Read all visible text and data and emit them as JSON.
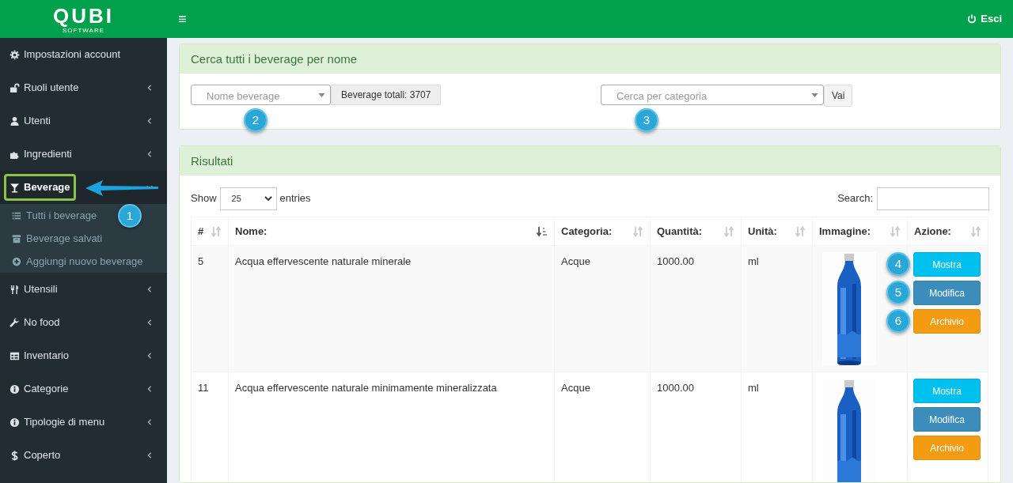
{
  "logo": {
    "name": "QUBI",
    "tagline": "SOFTWARE"
  },
  "topbar": {
    "menu_toggle": "≡",
    "logout": "Esci"
  },
  "sidebar": {
    "items": [
      {
        "label": "Impostazioni account",
        "kind": "link"
      },
      {
        "label": "Ruoli utente",
        "kind": "menu",
        "expanded": false
      },
      {
        "label": "Utenti",
        "kind": "menu",
        "expanded": false
      },
      {
        "label": "Ingredienti",
        "kind": "menu",
        "expanded": false
      },
      {
        "label": "Beverage",
        "kind": "menu",
        "expanded": true,
        "highlighted": true,
        "children": [
          {
            "label": "Tutti i beverage",
            "callout": "1"
          },
          {
            "label": "Beverage salvati"
          },
          {
            "label": "Aggiungi nuovo beverage"
          }
        ]
      },
      {
        "label": "Utensili",
        "kind": "menu",
        "expanded": false
      },
      {
        "label": "No food",
        "kind": "menu",
        "expanded": false
      },
      {
        "label": "Inventario",
        "kind": "menu",
        "expanded": false
      },
      {
        "label": "Categorie",
        "kind": "menu",
        "expanded": false
      },
      {
        "label": "Tipologie di menu",
        "kind": "menu",
        "expanded": false
      },
      {
        "label": "Coperto",
        "kind": "menu",
        "expanded": false
      }
    ]
  },
  "search_panel": {
    "title": "Cerca tutti i beverage per nome",
    "name_select": {
      "placeholder": "Nome beverage",
      "callout": "2"
    },
    "total": "Beverage totali: 3707",
    "category_select": {
      "placeholder": "Cerca per categoria",
      "callout": "3"
    },
    "go_button": "Vai"
  },
  "results_panel": {
    "title": "Risultati",
    "length": {
      "before": "Show",
      "value": "25",
      "after": "entries"
    },
    "search_label": "Search:",
    "table": {
      "columns": [
        {
          "label": "#",
          "sorted": false
        },
        {
          "label": "Nome:",
          "sorted": true
        },
        {
          "label": "Categoria:",
          "sorted": false
        },
        {
          "label": "Quantità:",
          "sorted": false
        },
        {
          "label": "Unità:",
          "sorted": false
        },
        {
          "label": "Immagine:",
          "sorted": false
        },
        {
          "label": "Azione:",
          "sorted": false
        }
      ],
      "rows": [
        {
          "id": "5",
          "name": "Acqua effervescente naturale minerale",
          "category": "Acque",
          "quantity": "1000.00",
          "unit": "ml",
          "actions": [
            {
              "label": "Mostra",
              "kind": "show",
              "callout": "4"
            },
            {
              "label": "Modifica",
              "kind": "edit",
              "callout": "5"
            },
            {
              "label": "Archivio",
              "kind": "archive",
              "callout": "6"
            }
          ]
        },
        {
          "id": "11",
          "name": "Acqua effervescente naturale minimamente mineralizzata",
          "category": "Acque",
          "quantity": "1000.00",
          "unit": "ml",
          "actions": [
            {
              "label": "Mostra",
              "kind": "show"
            },
            {
              "label": "Modifica",
              "kind": "edit"
            },
            {
              "label": "Archivio",
              "kind": "archive"
            }
          ]
        }
      ]
    }
  }
}
